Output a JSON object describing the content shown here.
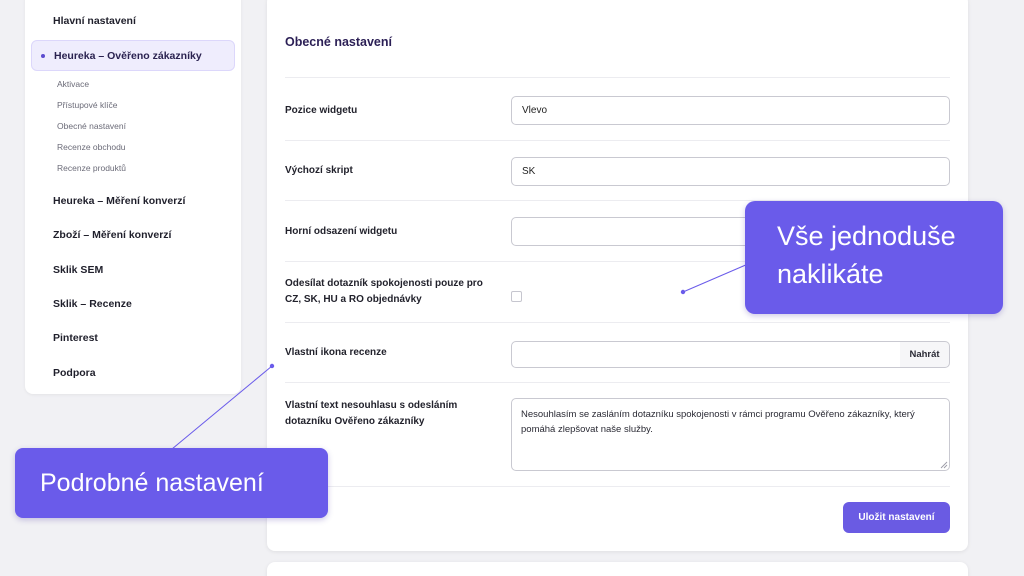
{
  "sidebar": {
    "items": [
      {
        "label": "Hlavní nastavení"
      },
      {
        "label": "Heureka – Ověřeno zákazníky",
        "active": true,
        "subitems": [
          "Aktivace",
          "Přístupové klíče",
          "Obecné nastavení",
          "Recenze obchodu",
          "Recenze produktů"
        ]
      },
      {
        "label": "Heureka – Měření konverzí"
      },
      {
        "label": "Zboží – Měření konverzí"
      },
      {
        "label": "Sklik SEM"
      },
      {
        "label": "Sklik – Recenze"
      },
      {
        "label": "Pinterest"
      },
      {
        "label": "Podpora"
      }
    ]
  },
  "main": {
    "title": "Obecné nastavení",
    "fields": {
      "widget_position": {
        "label": "Pozice widgetu",
        "value": "Vlevo"
      },
      "default_script": {
        "label": "Výchozí skript",
        "value": "SK"
      },
      "widget_top_offset": {
        "label": "Horní odsazení widgetu",
        "value": ""
      },
      "send_questionnaire": {
        "label": "Odesílat dotazník spokojenosti pouze pro CZ, SK, HU a RO objednávky",
        "checked": false
      },
      "custom_icon": {
        "label": "Vlastní ikona recenze",
        "value": "",
        "upload_label": "Nahrát"
      },
      "disagree_text": {
        "label": "Vlastní text nesouhlasu s odesláním dotazníku Ověřeno zákazníky",
        "value": "Nesouhlasím se zasláním dotazníku spokojenosti v rámci programu Ověřeno zákazníky, který pomáhá zlepšovat naše služby."
      }
    },
    "save_label": "Uložit nastavení"
  },
  "callouts": {
    "right_line1": "Vše jednoduše",
    "right_line2": "naklikáte",
    "left": "Podrobné nastavení"
  },
  "colors": {
    "accent": "#6a5be3",
    "callout": "#6a5bea",
    "background": "#f1f1f4",
    "title": "#2b1f55"
  }
}
